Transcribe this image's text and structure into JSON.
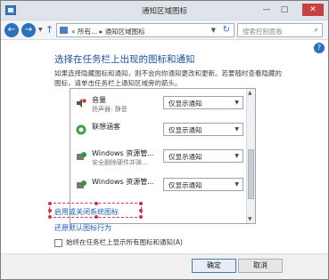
{
  "window": {
    "title": "通知区域图标",
    "controls": {
      "minimize": "—",
      "maximize": "□",
      "close": "✕"
    }
  },
  "navbar": {
    "address_path": "«  所有... ▸ 通知区域图标",
    "search_placeholder": "搜索控制面板"
  },
  "main": {
    "heading": "选择在任务栏上出现的图标和通知",
    "description": "如果选择隐藏图标和通知，则不会向你通知更改和更新。若要随时查看隐藏的图标，请单击任务栏上通知区域旁的箭头。",
    "rows": [
      {
        "name": "音量",
        "sub": "扬声器: 静音",
        "value": "仅显示通知",
        "icon": "speaker-icon"
      },
      {
        "name": "联想涵客",
        "sub": "",
        "value": "仅显示通知",
        "icon": "app-icon"
      },
      {
        "name": "Windows 资源管...",
        "sub": "安全删除硬件并弹...",
        "value": "仅显示通知",
        "icon": "usb-icon"
      },
      {
        "name": "Windows 资源管...",
        "sub": "",
        "value": "仅显示通知",
        "icon": "usb-icon"
      }
    ],
    "link_system_icons": "启用或关闭系统图标",
    "link_restore": "还原默认图标行为",
    "checkbox_label": "始终在任务栏上显示所有图标和通知(A)"
  },
  "footer": {
    "ok": "确定",
    "cancel": "取消"
  },
  "colors": {
    "heading": "#1a4fa0",
    "link": "#1a5fb4",
    "highlight_box": "#d0324a"
  }
}
